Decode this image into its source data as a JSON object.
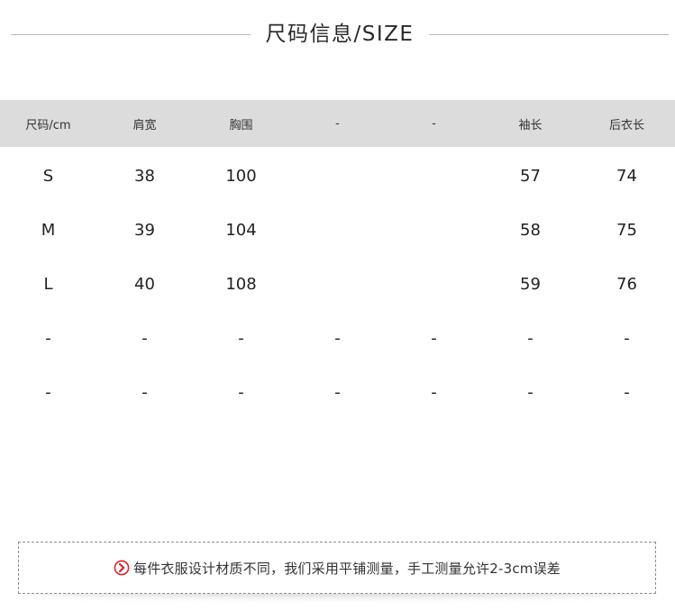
{
  "title": "尺码信息/SIZE",
  "table": {
    "headers": [
      "尺码/cm",
      "肩宽",
      "胸围",
      "-",
      "-",
      "袖长",
      "后衣长"
    ],
    "rows": [
      [
        "S",
        "38",
        "100",
        "",
        "",
        "57",
        "74"
      ],
      [
        "M",
        "39",
        "104",
        "",
        "",
        "58",
        "75"
      ],
      [
        "L",
        "40",
        "108",
        "",
        "",
        "59",
        "76"
      ],
      [
        "-",
        "-",
        "-",
        "-",
        "-",
        "-",
        "-"
      ],
      [
        "-",
        "-",
        "-",
        "-",
        "-",
        "-",
        "-"
      ]
    ]
  },
  "notice": {
    "icon": "chevron-right-circle-icon",
    "icon_color": "#d9232d",
    "text": "每件衣服设计材质不同，我们采用平铺测量，手工测量允许2-3cm误差"
  },
  "colors": {
    "header_bg": "#dcdcdc",
    "divider": "#b9b9b9"
  }
}
